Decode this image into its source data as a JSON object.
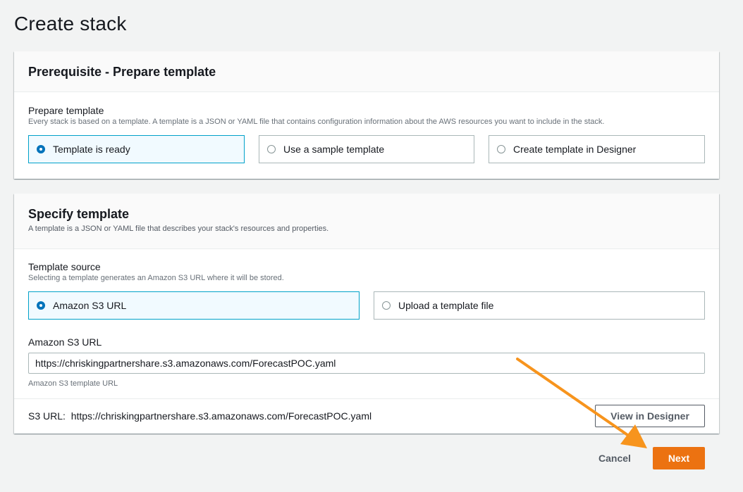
{
  "page": {
    "title": "Create stack"
  },
  "prerequisite": {
    "title": "Prerequisite - Prepare template",
    "field_label": "Prepare template",
    "field_desc": "Every stack is based on a template. A template is a JSON or YAML file that contains configuration information about the AWS resources you want to include in the stack.",
    "options": [
      {
        "label": "Template is ready",
        "selected": true
      },
      {
        "label": "Use a sample template",
        "selected": false
      },
      {
        "label": "Create template in Designer",
        "selected": false
      }
    ]
  },
  "specify": {
    "title": "Specify template",
    "subtitle": "A template is a JSON or YAML file that describes your stack's resources and properties.",
    "source_label": "Template source",
    "source_desc": "Selecting a template generates an Amazon S3 URL where it will be stored.",
    "source_options": [
      {
        "label": "Amazon S3 URL",
        "selected": true
      },
      {
        "label": "Upload a template file",
        "selected": false
      }
    ],
    "url_label": "Amazon S3 URL",
    "url_value": "https://chriskingpartnershare.s3.amazonaws.com/ForecastPOC.yaml",
    "url_hint": "Amazon S3 template URL",
    "s3_url_prefix": "S3 URL:",
    "s3_url_value": "https://chriskingpartnershare.s3.amazonaws.com/ForecastPOC.yaml",
    "view_designer_label": "View in Designer"
  },
  "footer": {
    "cancel_label": "Cancel",
    "next_label": "Next"
  },
  "colors": {
    "accent": "#ec7211",
    "selected_border": "#00a1c9",
    "radio": "#0073bb",
    "annotation_arrow": "#f7941d"
  }
}
